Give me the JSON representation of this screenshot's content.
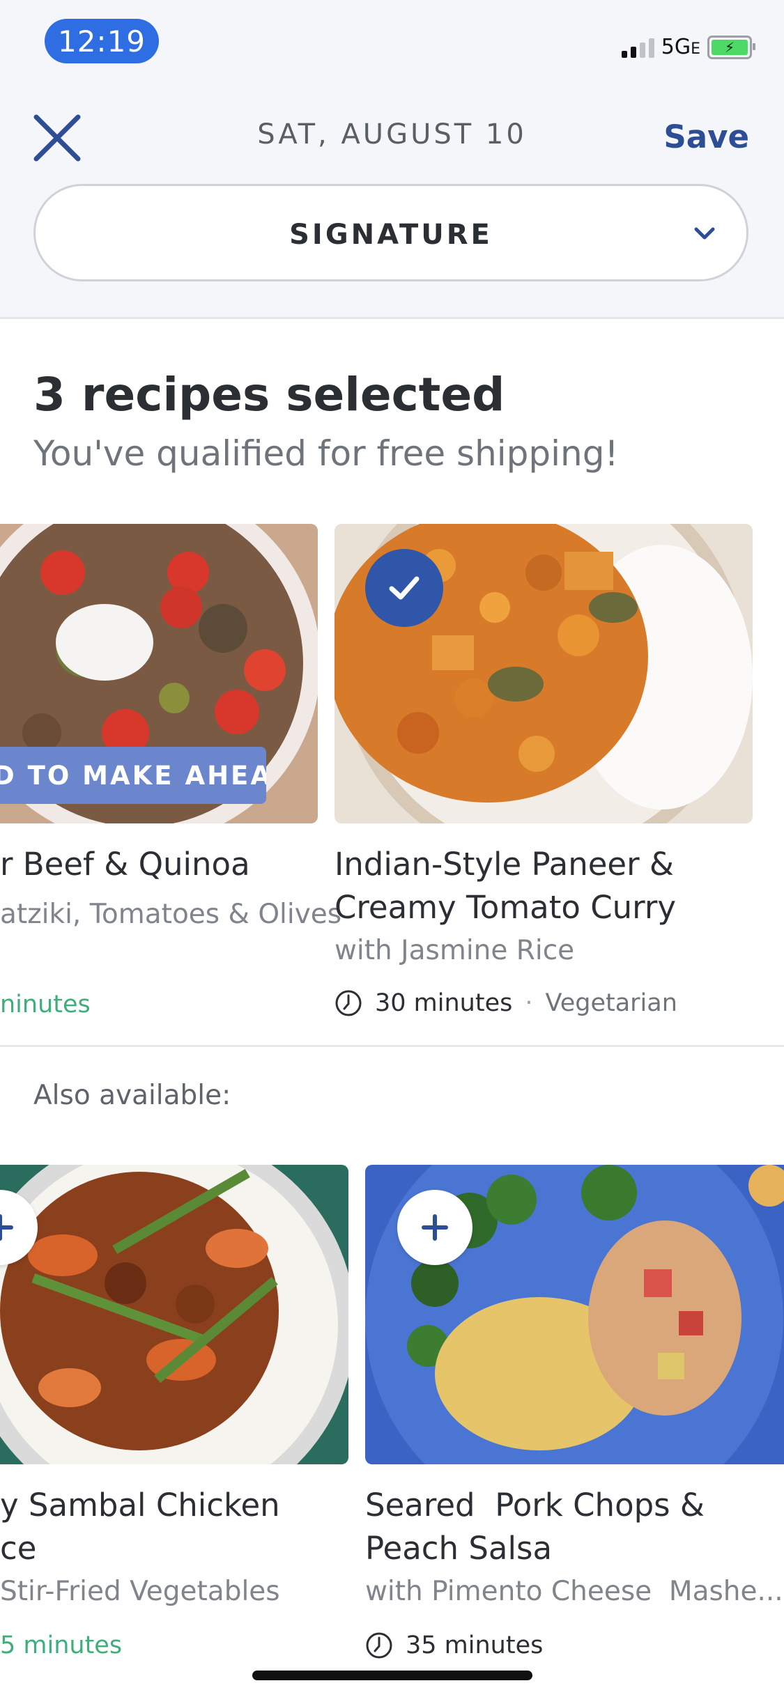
{
  "status_bar": {
    "time": "12:19",
    "network": "5G",
    "network_suffix": "E"
  },
  "header": {
    "date": "SAT, AUGUST 10",
    "save_label": "Save",
    "plan_select": "SIGNATURE"
  },
  "summary": {
    "count_text": "3 recipes selected",
    "shipping_text": "You've qualified for free shipping!"
  },
  "selected_recipes": [
    {
      "title_line1": "r Beef & Quinoa",
      "description": "atziki, Tomatoes & Olives",
      "time": "ninutes",
      "badge": "D TO MAKE AHEAD"
    },
    {
      "title_line1": "Indian-Style Paneer &",
      "title_line2": "Creamy Tomato Curry",
      "description": "with Jasmine Rice",
      "time": "30 minutes",
      "separator": "·",
      "tag": "Vegetarian"
    }
  ],
  "also_available": {
    "label": "Also available:",
    "recipes": [
      {
        "title_line1": "y Sambal Chicken",
        "title_line2": "ce",
        "description": "Stir-Fried Vegetables",
        "time": "5 minutes"
      },
      {
        "title_line1": "Seared  Pork Chops &",
        "title_line2": "Peach Salsa",
        "description": "with Pimento Cheese  Mashe...",
        "time": "35 minutes"
      }
    ]
  },
  "colors": {
    "accent_blue": "#2f56a8",
    "save_blue": "#2d4d94",
    "time_green": "#3fae7a",
    "badge_blue": "#6b86cc"
  }
}
